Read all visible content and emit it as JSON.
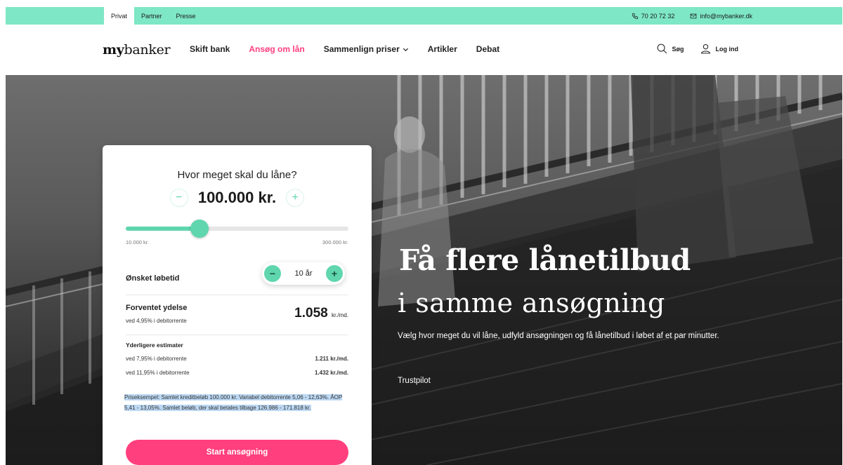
{
  "topbar": {
    "tabs": [
      "Privat",
      "Partner",
      "Presse"
    ],
    "phone": "70 20 72 32",
    "email": "info@mybanker.dk"
  },
  "nav": {
    "logo_bold": "my",
    "logo_rest": "banker",
    "links": [
      "Skift bank",
      "Ansøg om lån",
      "Sammenlign priser",
      "Artikler",
      "Debat"
    ],
    "search": "Søg",
    "login": "Log ind"
  },
  "calculator": {
    "question": "Hvor meget skal du låne?",
    "amount": "100.000 kr.",
    "slider_fraction": 0.33,
    "range_min": "10.000 kr.",
    "range_max": "300.000 kr.",
    "term_label": "Ønsket løbetid",
    "term_value": "10 år",
    "payment_label": "Forventet ydelse",
    "payment_rate": "ved 4,95% i debitorrente",
    "payment_value": "1.058",
    "payment_unit": "kr./md.",
    "estimates_title": "Yderligere estimater",
    "estimates": [
      {
        "label": "ved 7,95% i debitorrente",
        "value": "1.211 kr./md."
      },
      {
        "label": "ved 11,95% i debitorrente",
        "value": "1.432 kr./md."
      }
    ],
    "price_example": "Priseksempel: Samlet kreditbeløb 100.000 kr. Variabel debitorrente 5,06 - 12,63%. ÅOP 5,41 - 13,05%. Samlet beløb, der skal betales tilbage 126.986 - 171.818 kr.",
    "start_button": "Start ansøgning"
  },
  "hero": {
    "title_line1": "Få flere lånetilbud",
    "title_line2": "i samme ansøgning",
    "subtitle": "Vælg hvor meget du vil låne, udfyld ansøgningen og få lånetilbud i løbet af et par minutter.",
    "trustpilot": "Trustpilot"
  },
  "colors": {
    "mint": "#7ee7c5",
    "accent_green": "#5fd6ae",
    "pink": "#ff3f7e"
  }
}
